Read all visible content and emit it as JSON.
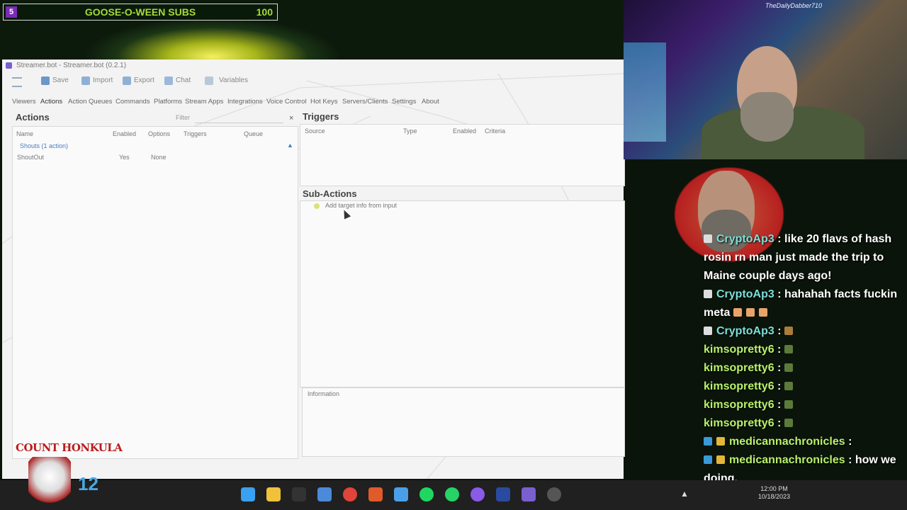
{
  "overlay": {
    "goal": {
      "count": "5",
      "title": "GOOSE-O-WEEN SUBS",
      "target": "100"
    },
    "webcam_name": "TheDailyDabber710",
    "logo_text": "COUNT HONKULA",
    "logo_number": "12"
  },
  "app": {
    "title": "Streamer.bot - Streamer.bot (0.2.1)",
    "toolbar": {
      "save": "Save",
      "import": "Import",
      "export": "Export",
      "chat": "Chat",
      "variables": "Variables"
    },
    "menu": [
      "Viewers",
      "Actions",
      "Action Queues",
      "Commands",
      "Platforms",
      "Stream Apps",
      "Integrations",
      "Voice Control",
      "Hot Keys",
      "Servers/Clients",
      "Settings",
      "About"
    ],
    "actions": {
      "title": "Actions",
      "filter_label": "Filter",
      "columns": [
        "Name",
        "Enabled",
        "Options",
        "Triggers",
        "Queue"
      ],
      "group": "Shouts (1 action)",
      "row": {
        "name": "ShoutOut",
        "enabled": "Yes",
        "triggers": "None"
      }
    },
    "triggers": {
      "title": "Triggers",
      "columns": [
        "Source",
        "Type",
        "Enabled",
        "Criteria"
      ]
    },
    "subactions": {
      "title": "Sub-Actions",
      "item": "Add target info from input"
    },
    "information": {
      "title": "Information"
    }
  },
  "chat": [
    {
      "user": "CryptoAp3",
      "text": "like 20 flavs of hash rosin rn man just made the trip to Maine couple days ago!"
    },
    {
      "user": "CryptoAp3",
      "text": "hahahah facts fuckin meta"
    },
    {
      "user": "CryptoAp3",
      "text": ""
    },
    {
      "user": "kimsopretty6",
      "text": ""
    },
    {
      "user": "kimsopretty6",
      "text": ""
    },
    {
      "user": "kimsopretty6",
      "text": ""
    },
    {
      "user": "kimsopretty6",
      "text": ""
    },
    {
      "user": "kimsopretty6",
      "text": ""
    },
    {
      "user": "medicannachronicles",
      "text": ""
    },
    {
      "user": "medicannachronicles",
      "text": "how we doing."
    }
  ],
  "taskbar": {
    "time": "12:00 PM",
    "date": "10/18/2023"
  },
  "colors": {
    "accent": "#a6d93a",
    "chat_user": "#b9f26a",
    "crypto_user": "#7be0d8"
  }
}
